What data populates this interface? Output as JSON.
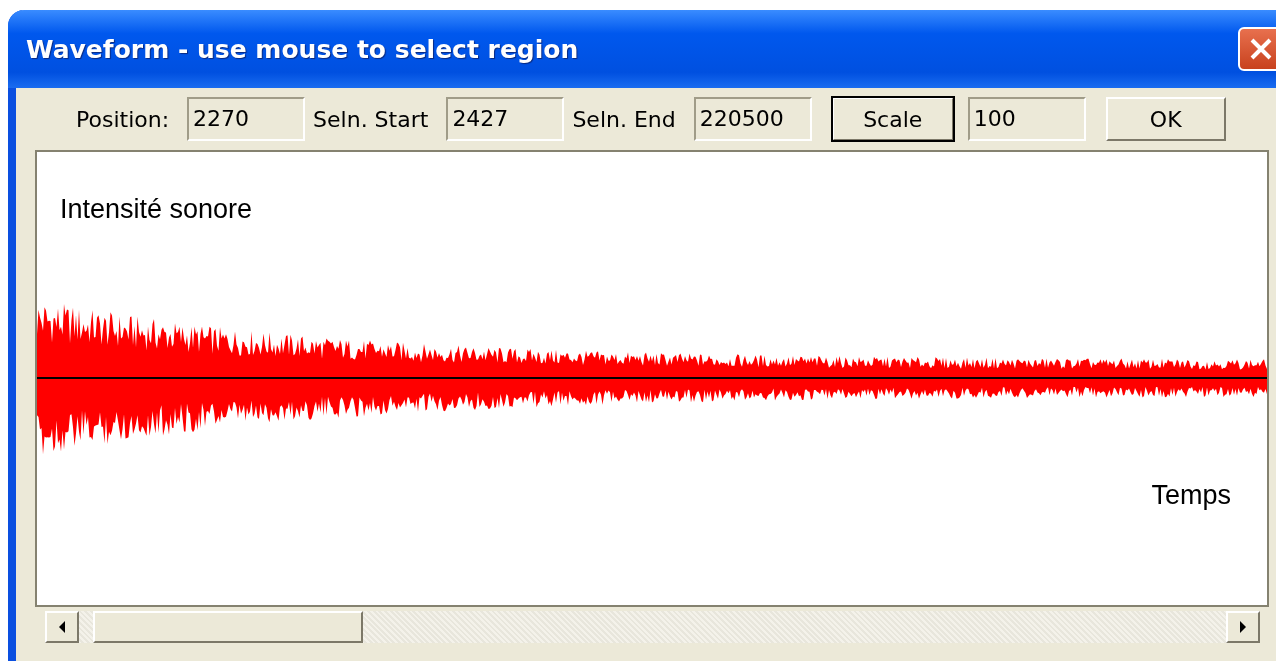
{
  "window": {
    "title": "Waveform - use mouse to select region"
  },
  "toolbar": {
    "fields": [
      {
        "label": "Position:",
        "value": "2270"
      },
      {
        "label": "Seln. Start",
        "value": "2427"
      },
      {
        "label": "Seln. End",
        "value": "220500"
      }
    ],
    "scale_button": "Scale",
    "scale_value": "100",
    "ok_button": "OK"
  },
  "plot": {
    "y_label": "Intensité sonore",
    "x_label": "Temps"
  }
}
